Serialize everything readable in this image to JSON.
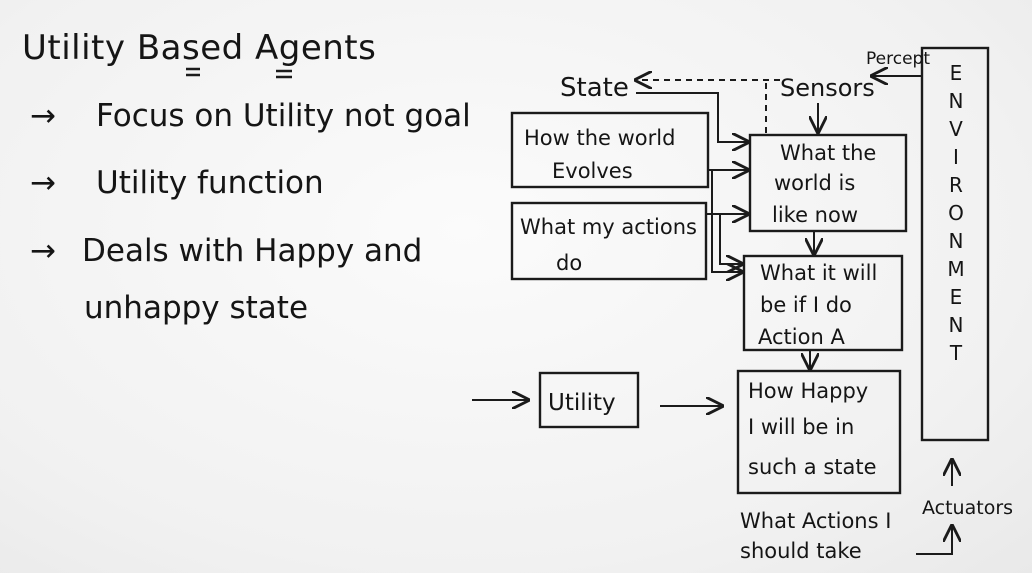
{
  "notes": {
    "title": "Utility Based Agents",
    "bullets": [
      {
        "arrow": "→",
        "text": "Focus on Utility not goal"
      },
      {
        "arrow": "→",
        "text": "Utility function"
      },
      {
        "arrow": "→",
        "text": "Deals with Happy and"
      }
    ],
    "bullet3_cont": "unhappy state"
  },
  "diagram": {
    "state": "State",
    "sensors": "Sensors",
    "percept": "Percept",
    "environment_letters": [
      "E",
      "N",
      "V",
      "I",
      "R",
      "O",
      "N",
      "M",
      "E",
      "N",
      "T"
    ],
    "box_world_evolves": [
      "How the world",
      "Evolves"
    ],
    "box_my_actions": [
      "What my actions",
      "do"
    ],
    "box_world_now": [
      "What the",
      "world is",
      "like now"
    ],
    "box_action_a": [
      "What it will",
      "be if I do",
      "Action A"
    ],
    "utility": "Utility",
    "box_happy": [
      "How Happy",
      "I will be in",
      "such a state"
    ],
    "what_actions": [
      "What Actions I",
      "should take"
    ],
    "actuators": "Actuators"
  }
}
